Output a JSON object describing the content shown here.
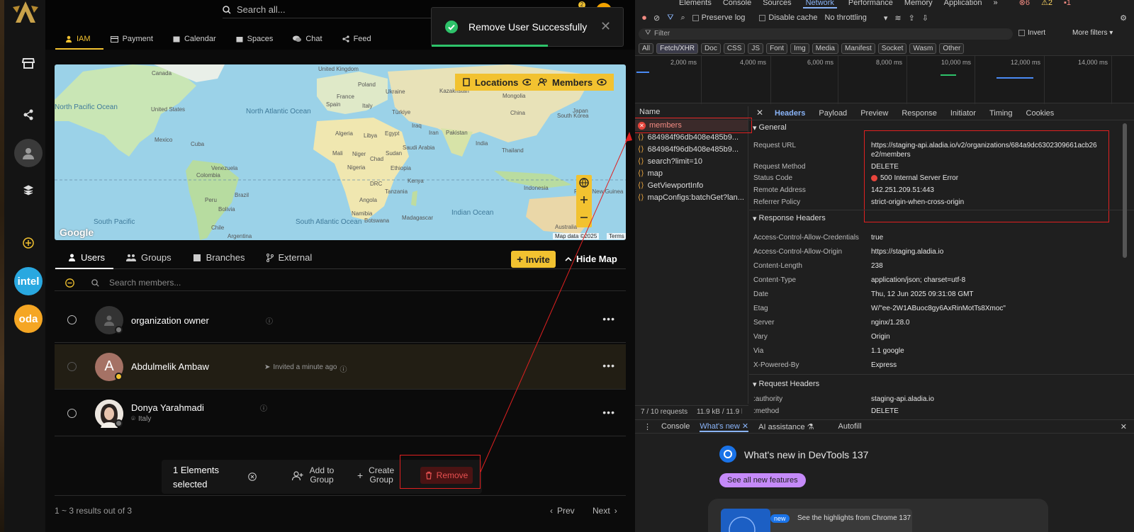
{
  "topbar": {
    "search_placeholder": "Search all...",
    "notification_count": "2"
  },
  "nav": {
    "tabs": [
      {
        "label": "IAM",
        "active": true
      },
      {
        "label": "Payment"
      },
      {
        "label": "Calendar"
      },
      {
        "label": "Spaces"
      },
      {
        "label": "Chat"
      },
      {
        "label": "Feed"
      }
    ]
  },
  "rail": {
    "avatars": [
      {
        "label": "intel",
        "color": "#29a8e0"
      },
      {
        "label": "oda",
        "color": "#f5a623"
      }
    ]
  },
  "toast": {
    "message": "Remove User Successfully"
  },
  "map": {
    "locations_label": "Locations",
    "members_label": "Members",
    "google_label": "Google",
    "map_data_label": "Map data ©2025",
    "terms_label": "Terms",
    "places": [
      "United Kingdom",
      "Canada",
      "United States",
      "Mexico",
      "Cuba",
      "Venezuela",
      "Colombia",
      "Peru",
      "Brazil",
      "Bolivia",
      "Chile",
      "Argentina",
      "Spain",
      "France",
      "Poland",
      "Ukraine",
      "Italy",
      "Türkiye",
      "Algeria",
      "Libya",
      "Egypt",
      "Iraq",
      "Iran",
      "Saudi Arabia",
      "Mali",
      "Niger",
      "Chad",
      "Sudan",
      "Nigeria",
      "Ethiopia",
      "Kenya",
      "DRC",
      "Tanzania",
      "Angola",
      "Namibia",
      "Botswana",
      "Madagascar",
      "Kazakhstan",
      "Mongolia",
      "China",
      "Pakistan",
      "India",
      "Thailand",
      "South Korea",
      "Japan",
      "Indonesia",
      "Australia",
      "Papua New Guinea"
    ],
    "oceans": [
      "North Pacific Ocean",
      "North Atlantic Ocean",
      "South Pacific",
      "South Atlantic Ocean",
      "Indian Ocean"
    ]
  },
  "subtabs": [
    {
      "label": "Users",
      "active": true
    },
    {
      "label": "Groups"
    },
    {
      "label": "Branches"
    },
    {
      "label": "External"
    }
  ],
  "actions": {
    "invite_label": "Invite",
    "hide_map_label": "Hide Map"
  },
  "members_search": {
    "placeholder": "Search members..."
  },
  "members": [
    {
      "name": "organization owner",
      "sub": "",
      "avatar": "default"
    },
    {
      "name": "Abdulmelik Ambaw",
      "sub": "Invited a minute ago",
      "avatar": "A",
      "selected": true
    },
    {
      "name": "Donya Yarahmadi",
      "sub": "Italy",
      "avatar": "photo"
    }
  ],
  "selection_bar": {
    "count_label": "1 Elements selected",
    "add_to_group_label": "Add to Group",
    "create_group_label": "Create Group",
    "remove_label": "Remove"
  },
  "pagination": {
    "summary": "1 ~ 3 results out of 3",
    "prev_label": "Prev",
    "next_label": "Next"
  },
  "devtools": {
    "tabs": [
      "Elements",
      "Console",
      "Sources",
      "Network",
      "Performance",
      "Memory",
      "Application"
    ],
    "counters": {
      "errors": "6",
      "warnings": "2",
      "info": "1"
    },
    "preserve_log": "Preserve log",
    "disable_cache": "Disable cache",
    "throttling": "No throttling",
    "filter_placeholder": "Filter",
    "invert": "Invert",
    "more_filters": "More filters",
    "filter_types": [
      "All",
      "Fetch/XHR",
      "Doc",
      "CSS",
      "JS",
      "Font",
      "Img",
      "Media",
      "Manifest",
      "Socket",
      "Wasm",
      "Other"
    ],
    "timeline_ticks": [
      "2,000 ms",
      "4,000 ms",
      "6,000 ms",
      "8,000 ms",
      "10,000 ms",
      "12,000 ms",
      "14,000 ms"
    ],
    "name_header": "Name",
    "requests": [
      "members",
      "684984f96db408e485b9...",
      "684984f96db408e485b9...",
      "search?limit=10",
      "map",
      "GetViewportInfo",
      "mapConfigs:batchGet?lan..."
    ],
    "detail_tabs": [
      "Headers",
      "Payload",
      "Preview",
      "Response",
      "Initiator",
      "Timing",
      "Cookies"
    ],
    "general_title": "General",
    "general": [
      {
        "k": "Request URL",
        "v": "https://staging-api.aladia.io/v2/organizations/684a9dc6302309661acb26",
        "v2": "e2/members"
      },
      {
        "k": "Request Method",
        "v": "DELETE"
      },
      {
        "k": "Status Code",
        "v": "500 Internal Server Error"
      },
      {
        "k": "Remote Address",
        "v": "142.251.209.51:443"
      },
      {
        "k": "Referrer Policy",
        "v": "strict-origin-when-cross-origin"
      }
    ],
    "response_title": "Response Headers",
    "response_headers": [
      {
        "k": "Access-Control-Allow-Credentials",
        "v": "true"
      },
      {
        "k": "Access-Control-Allow-Origin",
        "v": "https://staging.aladia.io"
      },
      {
        "k": "Content-Length",
        "v": "238"
      },
      {
        "k": "Content-Type",
        "v": "application/json; charset=utf-8"
      },
      {
        "k": "Date",
        "v": "Thu, 12 Jun 2025 09:31:08 GMT"
      },
      {
        "k": "Etag",
        "v": "W/\"ee-2W1ABuoc8gy6AxRinMotTs8Xmoc\""
      },
      {
        "k": "Server",
        "v": "nginx/1.28.0"
      },
      {
        "k": "Vary",
        "v": "Origin"
      },
      {
        "k": "Via",
        "v": "1.1 google"
      },
      {
        "k": "X-Powered-By",
        "v": "Express"
      }
    ],
    "request_title": "Request Headers",
    "request_headers": [
      {
        "k": ":authority",
        "v": "staging-api.aladia.io"
      },
      {
        "k": ":method",
        "v": "DELETE"
      }
    ],
    "status_requests": "7 / 10 requests",
    "status_size": "11.9 kB / 11.9 k",
    "drawer_tabs": [
      "Console",
      "What's new",
      "AI assistance",
      "Autofill"
    ],
    "whats_new_title": "What's new in DevTools 137",
    "see_all": "See all new features",
    "highlights": "See the highlights from Chrome 137",
    "new_badge": "new"
  }
}
